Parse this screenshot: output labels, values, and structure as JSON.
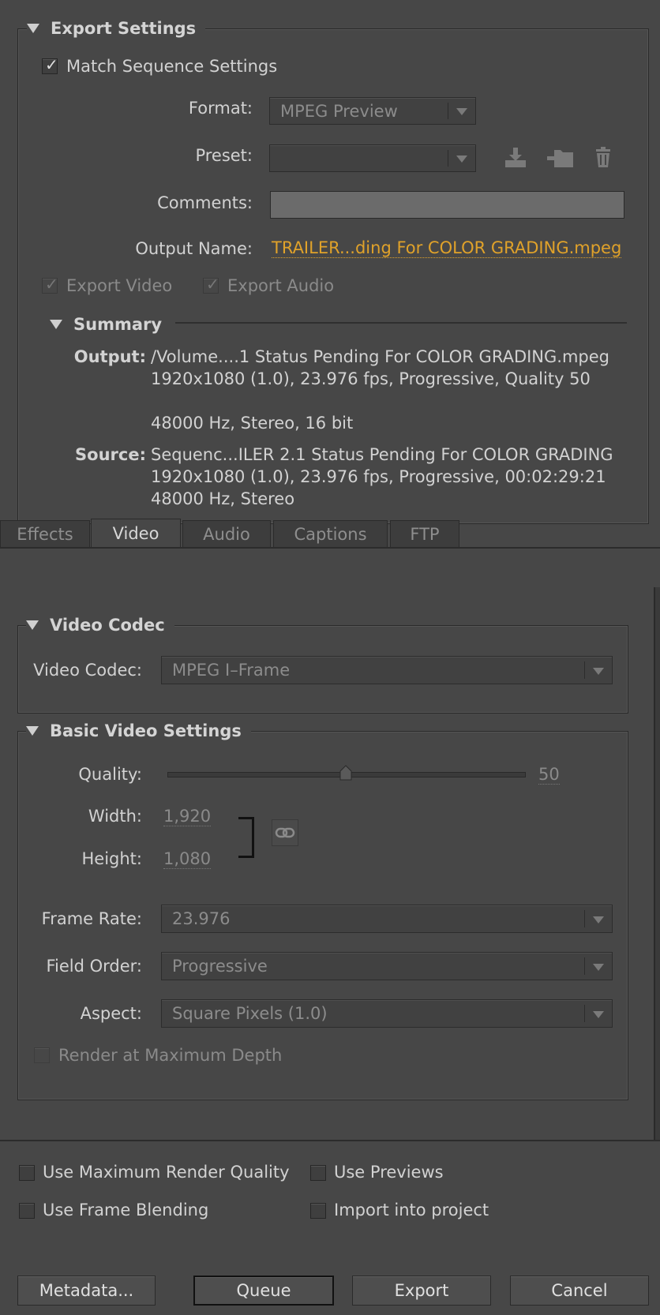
{
  "export_settings": {
    "title": "Export Settings",
    "match_sequence_label": "Match Sequence Settings",
    "match_sequence_checked": true,
    "format_label": "Format:",
    "format_value": "MPEG Preview",
    "preset_label": "Preset:",
    "preset_value": "",
    "comments_label": "Comments:",
    "comments_value": "",
    "output_name_label": "Output Name:",
    "output_name_value": "TRAILER...ding For COLOR GRADING.mpeg",
    "export_video_label": "Export Video",
    "export_audio_label": "Export Audio",
    "preset_icons": [
      "save-preset-icon",
      "import-preset-icon",
      "delete-preset-icon"
    ]
  },
  "summary": {
    "title": "Summary",
    "output_label": "Output:",
    "output_line1": "/Volume....1 Status Pending For COLOR GRADING.mpeg",
    "output_line2": "1920x1080 (1.0), 23.976 fps, Progressive, Quality 50",
    "output_line3": "48000 Hz, Stereo, 16 bit",
    "source_label": "Source:",
    "source_line1": "Sequenc...ILER 2.1 Status Pending For COLOR GRADING",
    "source_line2": "1920x1080 (1.0), 23.976 fps, Progressive, 00:02:29:21",
    "source_line3": "48000 Hz, Stereo"
  },
  "tabs": [
    {
      "label": "Effects",
      "active": false
    },
    {
      "label": "Video",
      "active": true
    },
    {
      "label": "Audio",
      "active": false
    },
    {
      "label": "Captions",
      "active": false
    },
    {
      "label": "FTP",
      "active": false
    }
  ],
  "video_codec": {
    "title": "Video Codec",
    "codec_label": "Video Codec:",
    "codec_value": "MPEG I–Frame"
  },
  "basic_video": {
    "title": "Basic Video Settings",
    "quality_label": "Quality:",
    "quality_value": "50",
    "quality_fraction": 0.5,
    "width_label": "Width:",
    "width_value": "1,920",
    "height_label": "Height:",
    "height_value": "1,080",
    "frame_rate_label": "Frame Rate:",
    "frame_rate_value": "23.976",
    "field_order_label": "Field Order:",
    "field_order_value": "Progressive",
    "aspect_label": "Aspect:",
    "aspect_value": "Square Pixels (1.0)",
    "max_depth_label": "Render at Maximum Depth"
  },
  "options": {
    "max_render_quality": "Use Maximum Render Quality",
    "use_previews": "Use Previews",
    "frame_blending": "Use Frame Blending",
    "import_into_project": "Import into project"
  },
  "buttons": {
    "metadata": "Metadata...",
    "queue": "Queue",
    "export": "Export",
    "cancel": "Cancel"
  },
  "colors": {
    "background": "#474747",
    "link_orange": "#e0a22a"
  }
}
